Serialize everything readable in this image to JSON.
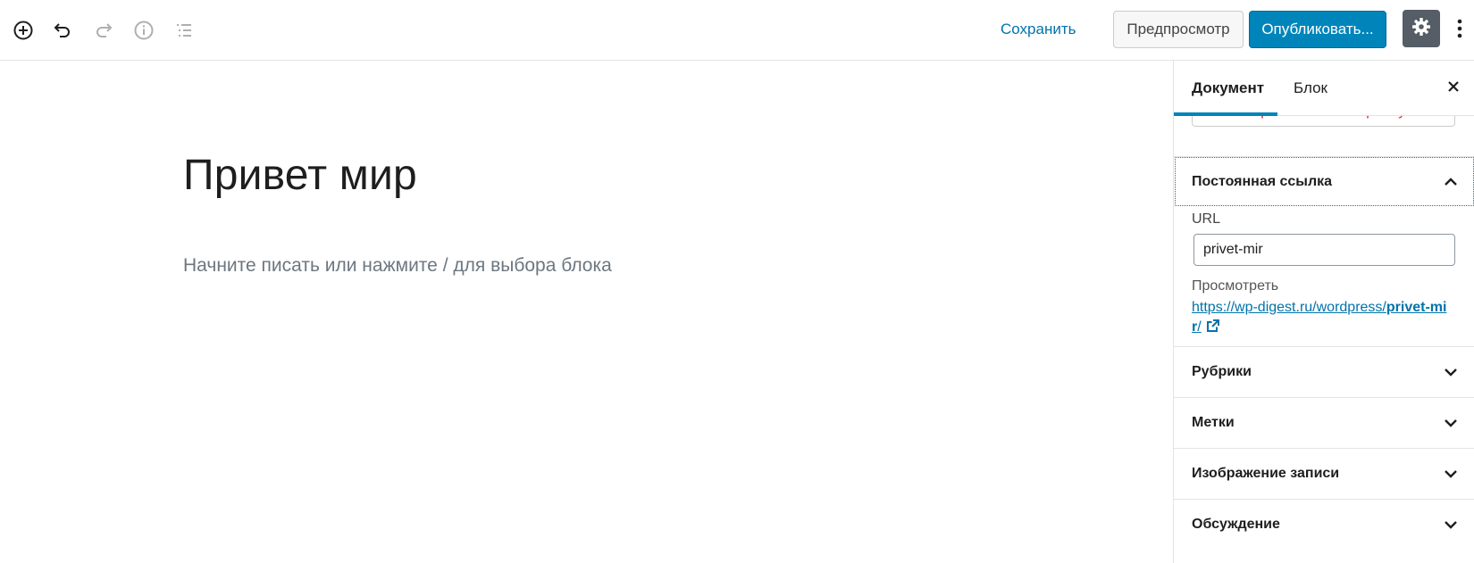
{
  "toolbar": {
    "icons": {
      "add": "add-block-icon",
      "undo": "undo-icon",
      "redo": "redo-icon",
      "info": "info-icon",
      "outline": "outline-icon"
    },
    "save_label": "Сохранить",
    "preview_label": "Предпросмотр",
    "publish_label": "Опубликовать...",
    "settings_icon": "gear-icon",
    "more_icon": "more-vertical-icon"
  },
  "editor": {
    "title": "Привет мир",
    "placeholder": "Начните писать или нажмите / для выбора блока"
  },
  "sidebar": {
    "tabs": [
      {
        "label": "Документ",
        "active": true
      },
      {
        "label": "Блок",
        "active": false
      }
    ],
    "close_icon": "close-icon",
    "trash_label": "Переместить в корзину",
    "permalink": {
      "title": "Постоянная ссылка",
      "expanded": true,
      "url_label": "URL",
      "url_value": "privet-mir",
      "view_label": "Просмотреть",
      "link_prefix": "https://wp-digest.ru/wordpress/",
      "link_slug": "privet-mir",
      "link_suffix": "/"
    },
    "panels": [
      {
        "title": "Рубрики",
        "expanded": false
      },
      {
        "title": "Метки",
        "expanded": false
      },
      {
        "title": "Изображение записи",
        "expanded": false
      },
      {
        "title": "Обсуждение",
        "expanded": false
      }
    ]
  },
  "colors": {
    "accent": "#0085ba",
    "link": "#0073aa",
    "danger": "#dc3232",
    "settings_bg": "#555d66"
  }
}
